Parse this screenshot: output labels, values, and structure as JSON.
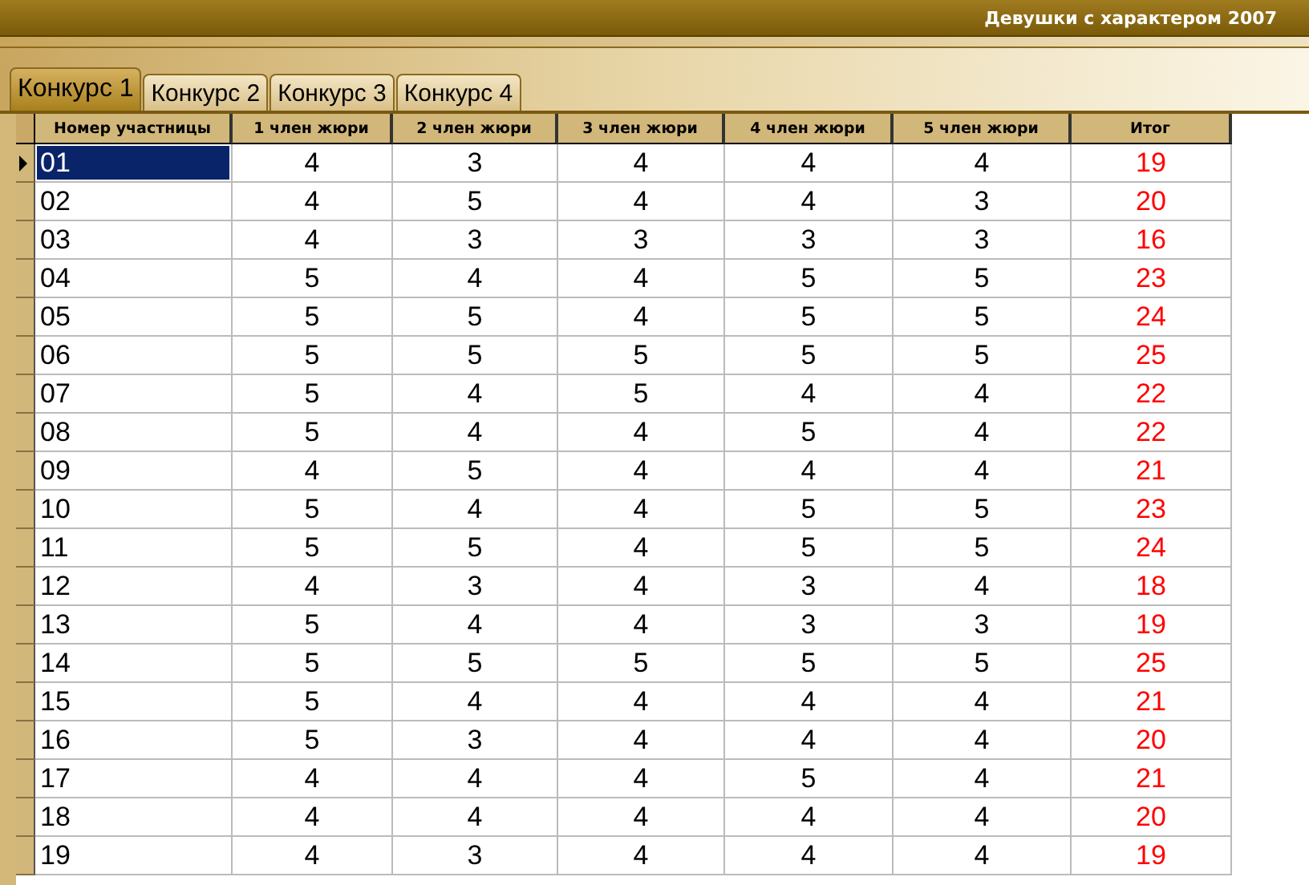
{
  "window": {
    "title": "Девушки с характером 2007"
  },
  "tabs": [
    {
      "label": "Конкурс 1",
      "selected": true
    },
    {
      "label": "Конкурс 2",
      "selected": false
    },
    {
      "label": "Конкурс 3",
      "selected": false
    },
    {
      "label": "Конкурс 4",
      "selected": false
    }
  ],
  "table": {
    "columns": [
      "Номер участницы",
      "1 член жюри",
      "2 член жюри",
      "3 член жюри",
      "4 член жюри",
      "5 член жюри",
      "Итог"
    ],
    "rows": [
      {
        "number": "01",
        "scores": [
          "4",
          "3",
          "4",
          "4",
          "4"
        ],
        "total": "19",
        "selected": true
      },
      {
        "number": "02",
        "scores": [
          "4",
          "5",
          "4",
          "4",
          "3"
        ],
        "total": "20",
        "selected": false
      },
      {
        "number": "03",
        "scores": [
          "4",
          "3",
          "3",
          "3",
          "3"
        ],
        "total": "16",
        "selected": false
      },
      {
        "number": "04",
        "scores": [
          "5",
          "4",
          "4",
          "5",
          "5"
        ],
        "total": "23",
        "selected": false
      },
      {
        "number": "05",
        "scores": [
          "5",
          "5",
          "4",
          "5",
          "5"
        ],
        "total": "24",
        "selected": false
      },
      {
        "number": "06",
        "scores": [
          "5",
          "5",
          "5",
          "5",
          "5"
        ],
        "total": "25",
        "selected": false
      },
      {
        "number": "07",
        "scores": [
          "5",
          "4",
          "5",
          "4",
          "4"
        ],
        "total": "22",
        "selected": false
      },
      {
        "number": "08",
        "scores": [
          "5",
          "4",
          "4",
          "5",
          "4"
        ],
        "total": "22",
        "selected": false
      },
      {
        "number": "09",
        "scores": [
          "4",
          "5",
          "4",
          "4",
          "4"
        ],
        "total": "21",
        "selected": false
      },
      {
        "number": "10",
        "scores": [
          "5",
          "4",
          "4",
          "5",
          "5"
        ],
        "total": "23",
        "selected": false
      },
      {
        "number": "11",
        "scores": [
          "5",
          "5",
          "4",
          "5",
          "5"
        ],
        "total": "24",
        "selected": false
      },
      {
        "number": "12",
        "scores": [
          "4",
          "3",
          "4",
          "3",
          "4"
        ],
        "total": "18",
        "selected": false
      },
      {
        "number": "13",
        "scores": [
          "5",
          "4",
          "4",
          "3",
          "3"
        ],
        "total": "19",
        "selected": false
      },
      {
        "number": "14",
        "scores": [
          "5",
          "5",
          "5",
          "5",
          "5"
        ],
        "total": "25",
        "selected": false
      },
      {
        "number": "15",
        "scores": [
          "5",
          "4",
          "4",
          "4",
          "4"
        ],
        "total": "21",
        "selected": false
      },
      {
        "number": "16",
        "scores": [
          "5",
          "3",
          "4",
          "4",
          "4"
        ],
        "total": "20",
        "selected": false
      },
      {
        "number": "17",
        "scores": [
          "4",
          "4",
          "4",
          "5",
          "4"
        ],
        "total": "21",
        "selected": false
      },
      {
        "number": "18",
        "scores": [
          "4",
          "4",
          "4",
          "4",
          "4"
        ],
        "total": "20",
        "selected": false
      },
      {
        "number": "19",
        "scores": [
          "4",
          "3",
          "4",
          "4",
          "4"
        ],
        "total": "19",
        "selected": false
      }
    ]
  }
}
